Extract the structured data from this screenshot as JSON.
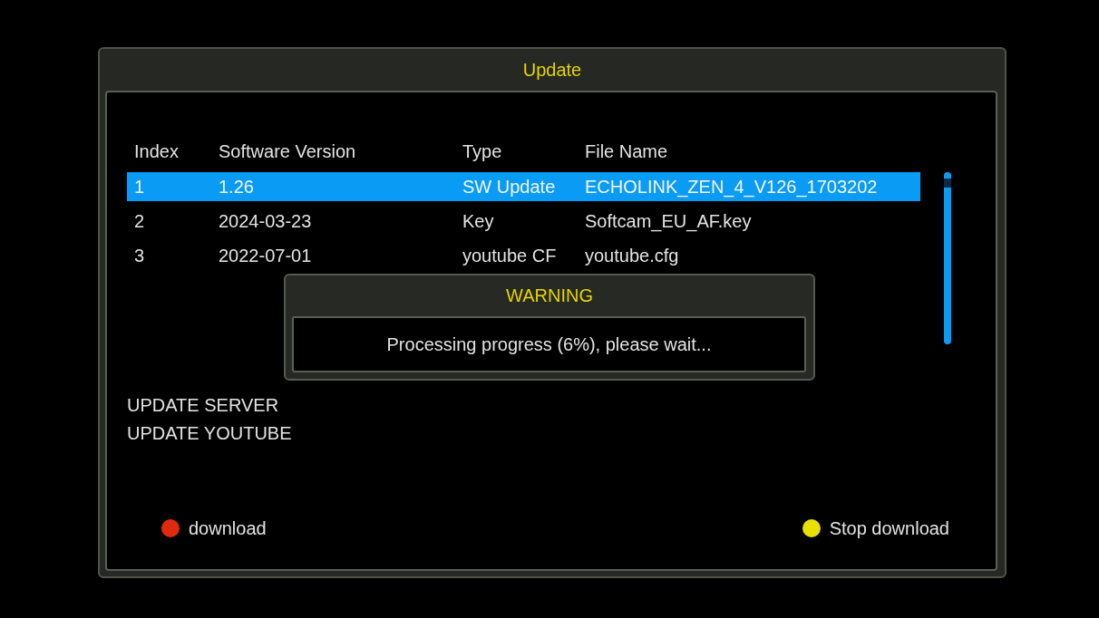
{
  "window": {
    "title": "Update"
  },
  "table": {
    "columns": [
      "Index",
      "Software Version",
      "Type",
      "File Name"
    ],
    "rows": [
      {
        "cells": [
          "1",
          "1.26",
          "SW Update",
          "ECHOLINK_ZEN_4_V126_1703202"
        ],
        "selected": true
      },
      {
        "cells": [
          "2",
          "2024-03-23",
          "Key",
          "Softcam_EU_AF.key"
        ],
        "selected": false
      },
      {
        "cells": [
          "3",
          "2022-07-01",
          "youtube CF",
          "youtube.cfg"
        ],
        "selected": false
      }
    ]
  },
  "entries": [
    "UPDATE SERVER",
    "UPDATE YOUTUBE"
  ],
  "dialog": {
    "title": "WARNING",
    "message": "Processing progress (6%), please wait..."
  },
  "legend": [
    {
      "label": "download",
      "color": "#e02a10"
    },
    {
      "label": "Stop download",
      "color": "#e8e000"
    }
  ]
}
